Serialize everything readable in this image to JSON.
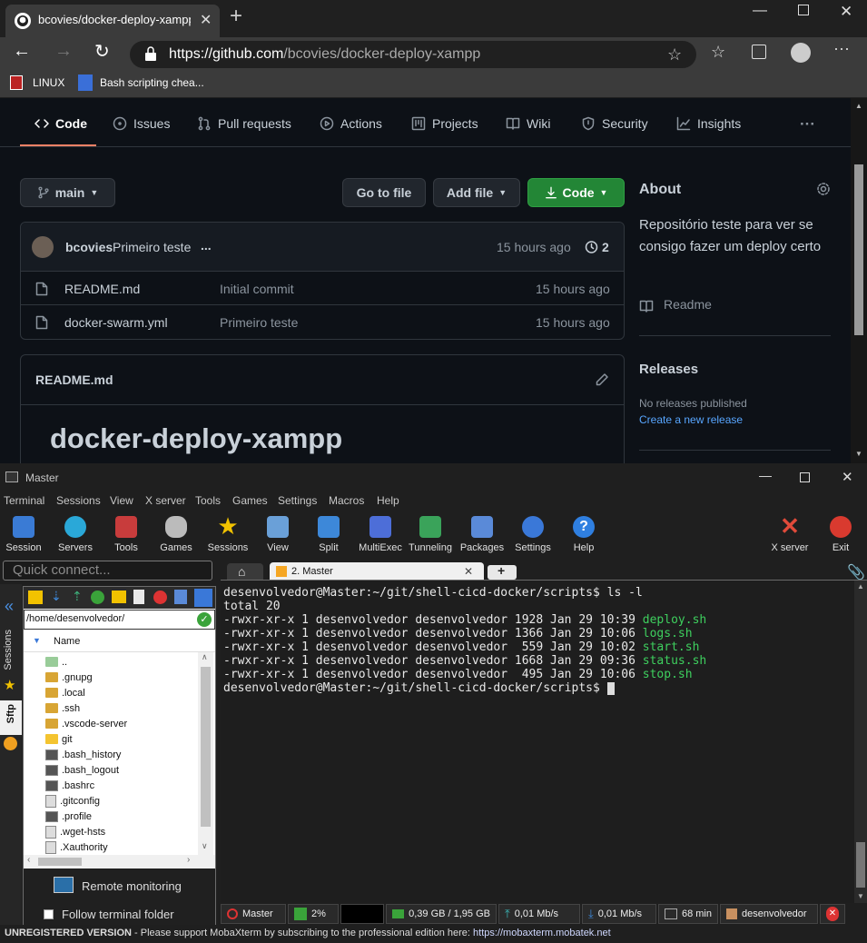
{
  "browser": {
    "tab_title": "bcovies/docker-deploy-xampp: P",
    "url_host": "https://github.com",
    "url_path": "/bcovies/docker-deploy-xampp",
    "bookmarks": [
      {
        "label": "LINUX"
      },
      {
        "label": "Bash scripting chea..."
      }
    ]
  },
  "github": {
    "nav": [
      {
        "label": "Code",
        "icon": "code-icon"
      },
      {
        "label": "Issues",
        "icon": "issue-icon"
      },
      {
        "label": "Pull requests",
        "icon": "pull-request-icon"
      },
      {
        "label": "Actions",
        "icon": "play-icon"
      },
      {
        "label": "Projects",
        "icon": "project-icon"
      },
      {
        "label": "Wiki",
        "icon": "book-icon"
      },
      {
        "label": "Security",
        "icon": "shield-icon"
      },
      {
        "label": "Insights",
        "icon": "graph-icon"
      }
    ],
    "more": "···",
    "branch": "main",
    "go_to_file": "Go to file",
    "add_file": "Add file",
    "code_button": "Code",
    "commit": {
      "author": "bcovies",
      "message": "Primeiro teste",
      "ellipsis": "...",
      "time": "15 hours ago",
      "count": "2"
    },
    "files": [
      {
        "name": "README.md",
        "message": "Initial commit",
        "time": "15 hours ago"
      },
      {
        "name": "docker-swarm.yml",
        "message": "Primeiro teste",
        "time": "15 hours ago"
      }
    ],
    "readme_label": "README.md",
    "readme_heading": "docker-deploy-xampp",
    "about": {
      "title": "About",
      "description": "Repositório teste para ver se consigo fazer um deploy certo",
      "readme": "Readme"
    },
    "releases": {
      "title": "Releases",
      "none": "No releases published",
      "create": "Create a new release"
    }
  },
  "moba": {
    "title": "Master",
    "menu": [
      "Terminal",
      "Sessions",
      "View",
      "X server",
      "Tools",
      "Games",
      "Settings",
      "Macros",
      "Help"
    ],
    "toolbar": [
      {
        "label": "Session",
        "color": "#3a7bd5"
      },
      {
        "label": "Servers",
        "color": "#2aa8d8"
      },
      {
        "label": "Tools",
        "color": "#c83c3c"
      },
      {
        "label": "Games",
        "color": "#bbbbbb"
      },
      {
        "label": "Sessions",
        "color": "#f2c200"
      },
      {
        "label": "View",
        "color": "#6aa0d8"
      },
      {
        "label": "Split",
        "color": "#3d88d9"
      },
      {
        "label": "MultiExec",
        "color": "#4d6ed8"
      },
      {
        "label": "Tunneling",
        "color": "#3aa35a"
      },
      {
        "label": "Packages",
        "color": "#5a8ad8"
      },
      {
        "label": "Settings",
        "color": "#3a78d8"
      },
      {
        "label": "Help",
        "color": "#2f7fe0"
      }
    ],
    "xserver": "X server",
    "exit": "Exit",
    "quick_connect": "Quick connect...",
    "session_tab": "2. Master",
    "side_tabs": {
      "sessions": "Sessions",
      "sftp": "Sftp"
    },
    "sftp": {
      "path": "/home/desenvolvedor/",
      "column": "Name",
      "items": [
        {
          "name": "..",
          "kind": "up"
        },
        {
          "name": ".gnupg",
          "kind": "folder"
        },
        {
          "name": ".local",
          "kind": "folder"
        },
        {
          "name": ".ssh",
          "kind": "folder"
        },
        {
          "name": ".vscode-server",
          "kind": "folder"
        },
        {
          "name": "git",
          "kind": "folder-yellow"
        },
        {
          "name": ".bash_history",
          "kind": "term"
        },
        {
          "name": ".bash_logout",
          "kind": "term"
        },
        {
          "name": ".bashrc",
          "kind": "term"
        },
        {
          "name": ".gitconfig",
          "kind": "doc"
        },
        {
          "name": ".profile",
          "kind": "term"
        },
        {
          "name": ".wget-hsts",
          "kind": "doc"
        },
        {
          "name": ".Xauthority",
          "kind": "doc"
        }
      ],
      "remote_monitoring": "Remote monitoring",
      "follow_folder": "Follow terminal folder"
    },
    "terminal": {
      "prompt": "desenvolvedor@Master:~/git/shell-cicd-docker/scripts$",
      "command": "ls -l",
      "total": "total 20",
      "rows": [
        {
          "meta": "-rwxr-xr-x 1 desenvolvedor desenvolvedor 1928 Jan 29 10:39",
          "file": "deploy.sh"
        },
        {
          "meta": "-rwxr-xr-x 1 desenvolvedor desenvolvedor 1366 Jan 29 10:06",
          "file": "logs.sh"
        },
        {
          "meta": "-rwxr-xr-x 1 desenvolvedor desenvolvedor  559 Jan 29 10:02",
          "file": "start.sh"
        },
        {
          "meta": "-rwxr-xr-x 1 desenvolvedor desenvolvedor 1668 Jan 29 09:36",
          "file": "status.sh"
        },
        {
          "meta": "-rwxr-xr-x 1 desenvolvedor desenvolvedor  495 Jan 29 10:06",
          "file": "stop.sh"
        }
      ],
      "file_color": "#3ecf5e"
    },
    "status": {
      "host": "Master",
      "cpu": "2%",
      "mem": "0,39 GB / 1,95 GB",
      "up": "0,01 Mb/s",
      "down": "0,01 Mb/s",
      "time": "68 min",
      "user": "desenvolvedor"
    },
    "footer": {
      "unregistered": "UNREGISTERED VERSION",
      "support": "-  Please support MobaXterm by subscribing to the professional edition here:",
      "url": "https://mobaxterm.mobatek.net"
    }
  }
}
